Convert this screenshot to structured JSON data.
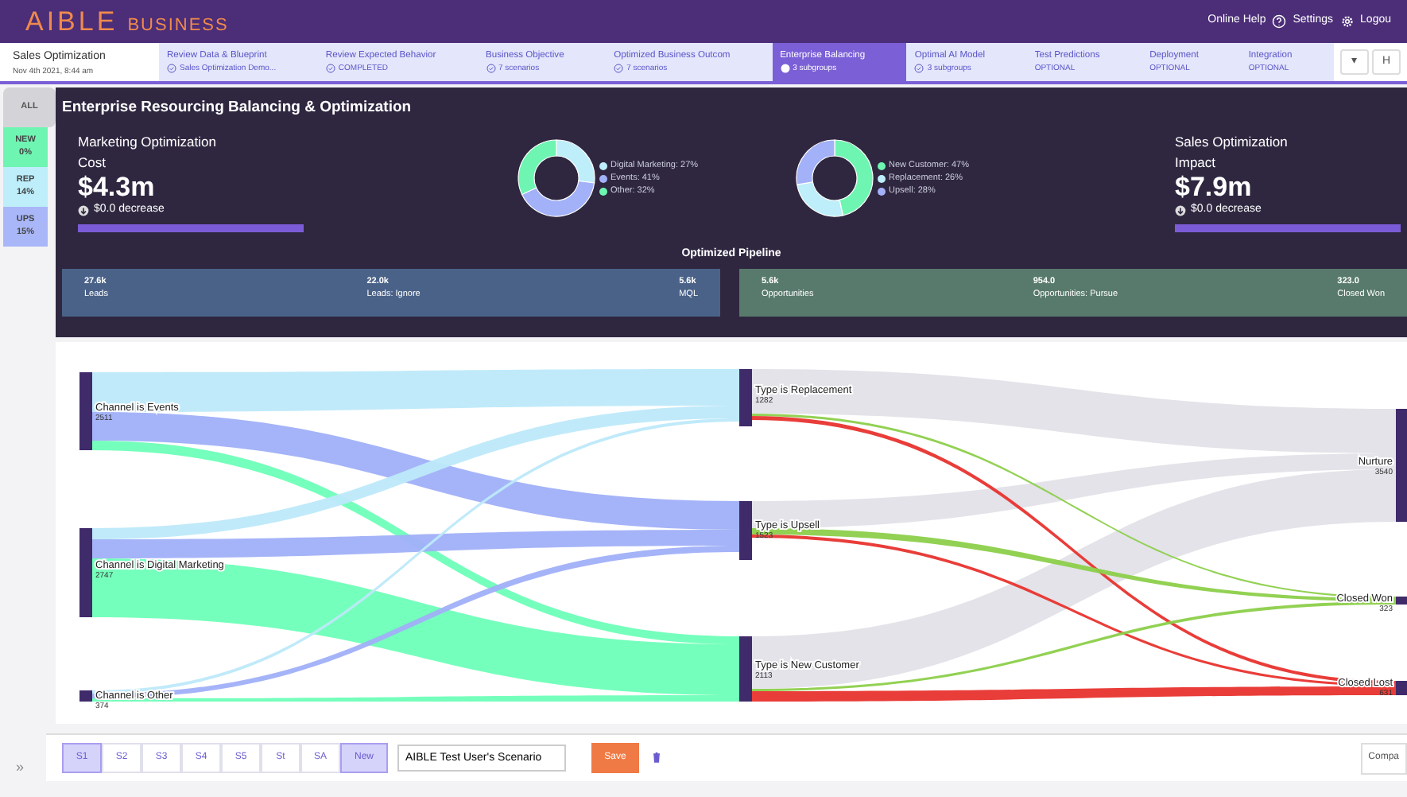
{
  "header": {
    "logo": "AIBLE",
    "logo_suffix": "BUSINESS",
    "links": [
      {
        "label": "Online Help",
        "kind": "help"
      },
      {
        "label": "Settings",
        "kind": "settings"
      },
      {
        "label": "Logou",
        "kind": "plain"
      }
    ]
  },
  "project": {
    "title": "Sales Optimization",
    "date": "Nov 4th 2021, 8:44 am"
  },
  "steps": [
    {
      "title": "Review Data & Blueprint",
      "subtitle": "Sales Optimization Demo...",
      "kind": "done",
      "selected": false
    },
    {
      "title": "Review Expected Behavior",
      "subtitle": "COMPLETED",
      "kind": "done",
      "selected": false
    },
    {
      "title": "Business Objective",
      "subtitle": "7 scenarios",
      "kind": "done",
      "selected": false
    },
    {
      "title": "Optimized Business Outcom",
      "subtitle": "7 scenarios",
      "kind": "done",
      "selected": false
    },
    {
      "title": "Enterprise Balancing",
      "subtitle": "3 subgroups",
      "kind": "current",
      "selected": true
    },
    {
      "title": "Optimal AI Model",
      "subtitle": "3 subgroups",
      "kind": "done",
      "selected": false
    },
    {
      "title": "Test Predictions",
      "subtitle": "OPTIONAL",
      "kind": "optional",
      "selected": false
    },
    {
      "title": "Deployment",
      "subtitle": "OPTIONAL",
      "kind": "optional",
      "selected": false
    },
    {
      "title": "Integration",
      "subtitle": "OPTIONAL",
      "kind": "optional",
      "selected": false
    }
  ],
  "step_buttons": [
    "▾",
    "H"
  ],
  "segments": [
    {
      "label": "ALL",
      "color": "#d4d4d8",
      "selected": true
    },
    {
      "label": "NEW",
      "value": "0%",
      "color": "#6ef5b2",
      "selected": false
    },
    {
      "label": "REP",
      "value": "14%",
      "color": "#bdeefa",
      "selected": false
    },
    {
      "label": "UPS",
      "value": "15%",
      "color": "#a9b7f8",
      "selected": false
    }
  ],
  "panel": {
    "title": "Enterprise Resourcing Balancing & Optimization",
    "metrics": [
      {
        "title": "Marketing Optimization",
        "subtitle": "Cost",
        "value": "$4.3m",
        "change": "$0.0 decrease"
      },
      {
        "title": "Sales Optimization",
        "subtitle": "Impact",
        "value": "$7.9m",
        "change": "$0.0 decrease"
      }
    ],
    "donuts": [
      {
        "legend": [
          {
            "label": "Digital Marketing: 27%",
            "color": "#bdeefa"
          },
          {
            "label": "Events: 41%",
            "color": "#a3b1f8"
          },
          {
            "label": "Other: 32%",
            "color": "#6ef5b2"
          }
        ],
        "chart_data": {
          "type": "donut",
          "values": [
            27,
            41,
            32
          ]
        }
      },
      {
        "legend": [
          {
            "label": "New Customer: 47%",
            "color": "#6ef5b2"
          },
          {
            "label": "Replacement: 26%",
            "color": "#bdeefa"
          },
          {
            "label": "Upsell: 28%",
            "color": "#a3b1f8"
          }
        ],
        "chart_data": {
          "type": "donut",
          "values": [
            47,
            26,
            28
          ]
        }
      }
    ],
    "pipeline_title": "Optimized Pipeline",
    "pipeline": [
      {
        "kind": "marketing",
        "stats": [
          {
            "value": "27.6k",
            "label": "Leads"
          },
          {
            "value": "22.0k",
            "label": "Leads: Ignore"
          },
          {
            "value": "5.6k",
            "label": "MQL"
          }
        ]
      },
      {
        "kind": "sales",
        "stats": [
          {
            "value": "5.6k",
            "label": "Opportunities"
          },
          {
            "value": "954.0",
            "label": "Opportunities: Pursue"
          },
          {
            "value": "323.0",
            "label": "Closed Won"
          }
        ]
      }
    ]
  },
  "sankey": {
    "nodes": [
      {
        "label": "Channel is Events",
        "value": "2511"
      },
      {
        "label": "Channel is Digital Marketing",
        "value": "2747"
      },
      {
        "label": "Channel is Other",
        "value": "374"
      },
      {
        "label": "Type is Replacement",
        "value": "1282"
      },
      {
        "label": "Type is Upsell",
        "value": "1523"
      },
      {
        "label": "Type is New Customer",
        "value": "2113"
      },
      {
        "label": "Nurture",
        "value": "3540"
      },
      {
        "label": "Closed Won",
        "value": "323"
      },
      {
        "label": "Closed Lost",
        "value": "631"
      }
    ]
  },
  "scenarios": [
    {
      "label": "S1",
      "selected": true
    },
    {
      "label": "S2",
      "selected": false
    },
    {
      "label": "S3",
      "selected": false
    },
    {
      "label": "S4",
      "selected": false
    },
    {
      "label": "S5",
      "selected": false
    },
    {
      "label": "St",
      "selected": false
    },
    {
      "label": "SA",
      "selected": false
    }
  ],
  "new_button": "New",
  "scenario_name": "AIBLE Test User's Scenario",
  "save_button": "Save",
  "compare_button": "Compa",
  "expand": "»"
}
